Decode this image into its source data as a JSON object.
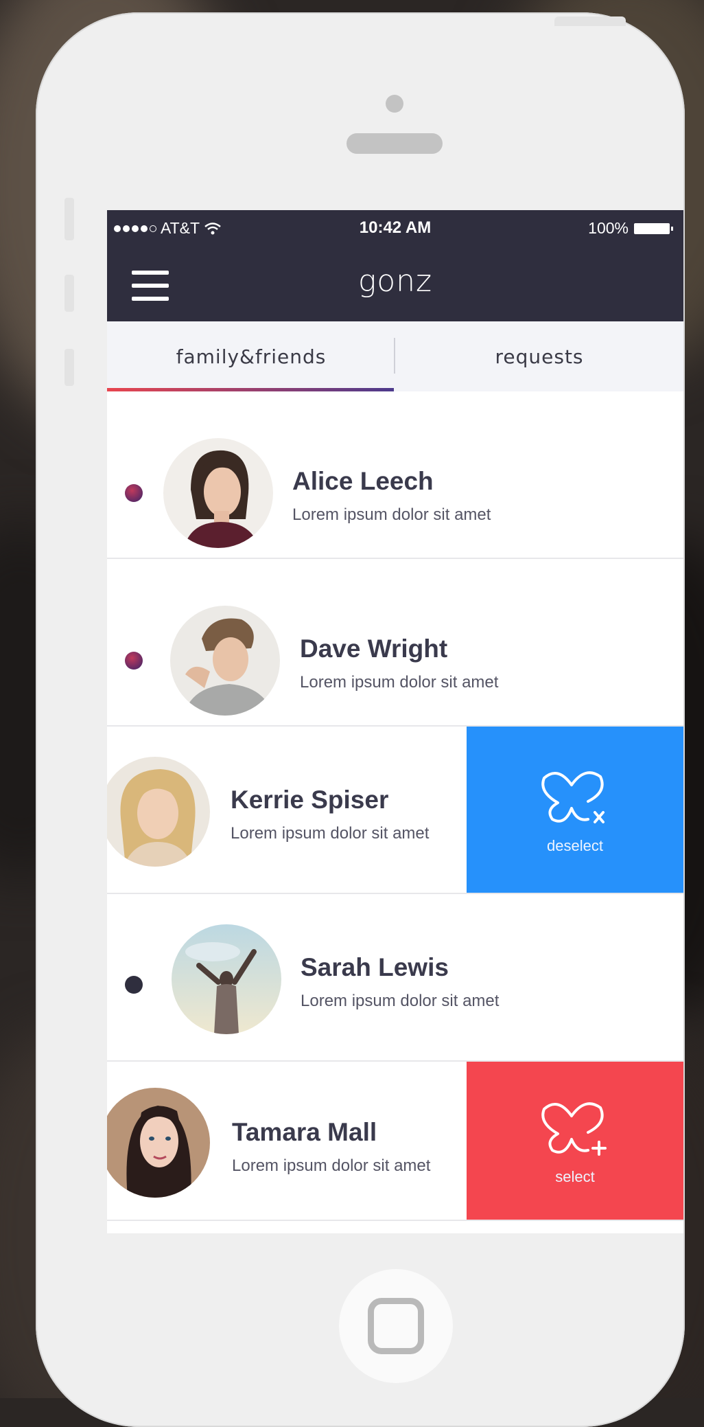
{
  "status_bar": {
    "carrier": "AT&T",
    "time": "10:42 AM",
    "battery": "100%"
  },
  "app": {
    "title": "gonz",
    "menu_icon": "hamburger-icon"
  },
  "tabs": [
    {
      "label": "family&friends",
      "active": true
    },
    {
      "label": "requests",
      "active": false
    }
  ],
  "contacts": [
    {
      "name": "Alice Leech",
      "subtitle": "Lorem ipsum dolor sit amet",
      "indicator_color": "#5e2a6b"
    },
    {
      "name": "Dave Wright",
      "subtitle": "Lorem ipsum dolor sit amet",
      "indicator_color": "#5e2a6b"
    },
    {
      "name": "Kerrie Spiser",
      "subtitle": "Lorem ipsum dolor sit amet",
      "action": {
        "label": "deselect",
        "color": "#2691fb",
        "icon": "butterfly-x-icon"
      }
    },
    {
      "name": "Sarah Lewis",
      "subtitle": "Lorem ipsum dolor sit amet",
      "indicator_color": "#2f2e3e"
    },
    {
      "name": "Tamara Mall",
      "subtitle": "Lorem ipsum dolor sit amet",
      "action": {
        "label": "select",
        "color": "#f4464f",
        "icon": "butterfly-plus-icon"
      }
    }
  ]
}
